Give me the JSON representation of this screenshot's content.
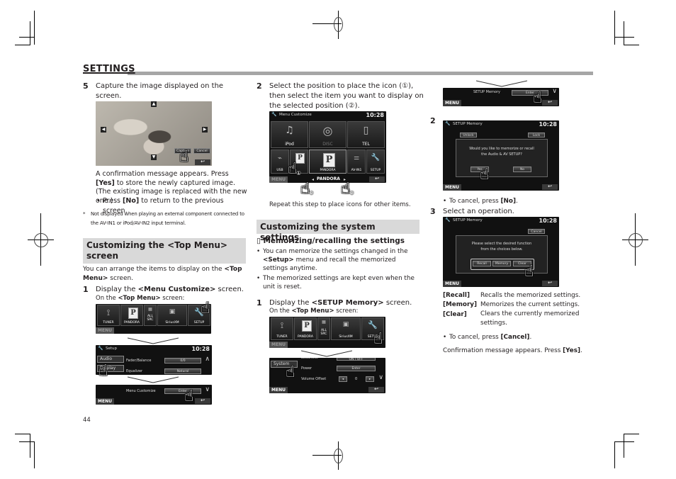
{
  "page": {
    "section_title": "SETTINGS",
    "page_number": "44"
  },
  "col1": {
    "step5": {
      "num": "5",
      "text": "Capture the image displayed on the screen.",
      "screen": {
        "capture_button": "Capture",
        "cancel_button": "Cancel",
        "back_button": "↩"
      },
      "confirm_text_1": "A confirmation message appears. Press ",
      "confirm_yes": "[Yes]",
      "confirm_text_2": " to store the newly captured image. (The existing image is replaced with the new one.)",
      "bullet_pre": "Press ",
      "bullet_no": "[No]",
      "bullet_post": " to return to the previous screen.",
      "footnote_mark": "*",
      "footnote_line1": "Not displayed when playing an external component connected to",
      "footnote_line2": "the AV-IN1 or iPod/AV-IN2 input terminal."
    },
    "topmenu_section": {
      "heading_line1": "Customizing the <Top Menu>",
      "heading_line2": "screen",
      "intro_pre": "You can arrange the items to display on the ",
      "intro_bold1": "<Top",
      "intro_bold2": "Menu>",
      "intro_post": " screen.",
      "step1_num": "1",
      "step1_pre": "Display the ",
      "step1_bold": "<Menu Customize>",
      "step1_post": " screen.",
      "step1_sub_pre": "On the ",
      "step1_sub_bold": "<Top Menu>",
      "step1_sub_post": " screen:"
    },
    "topmenu_screen": {
      "items": [
        "TUNER",
        "PANDORA",
        "ALL SRC",
        "SiriusXM",
        "SETUP"
      ],
      "menu": "MENU"
    },
    "setup_screen": {
      "title": "Setup",
      "clock": "10:28",
      "tabs": [
        "Audio",
        "Display"
      ],
      "rows": [
        {
          "label": "Fader/Balance",
          "value": "0/0"
        },
        {
          "label": "Equalizer",
          "value": "Natural"
        }
      ],
      "menu_customize_label": "Menu Customize",
      "enter": "Enter",
      "menu": "MENU"
    }
  },
  "col2": {
    "step2": {
      "num": "2",
      "text_1": "Select the position to place the icon (",
      "mark1": "①",
      "text_2": "), then select the item you want to display on the selected position (",
      "mark2": "②",
      "text_3": ").",
      "screen": {
        "title": "Menu Customize",
        "clock": "10:28",
        "top_items": [
          "iPod",
          "DISC",
          "TEL"
        ],
        "bottom_items": [
          "USB",
          "PANDORA",
          "AV-IN1",
          "SETUP"
        ],
        "selected_label": "PANDORA",
        "menu": "MENU"
      },
      "callout_1": "①",
      "callout_2": "②",
      "repeat_text": "Repeat this step to place icons for other items."
    },
    "system_section": {
      "heading": "Customizing the system settings",
      "sub_icon": "▯",
      "sub_heading": "Memorizing/recalling the settings",
      "bullet1_pre": "You can memorize the settings changed in the ",
      "bullet1_bold": "<Setup>",
      "bullet1_post": " menu and recall the memorized settings anytime.",
      "bullet2": "The memorized settings are kept even when the unit is reset.",
      "step1_num": "1",
      "step1_pre": "Display the ",
      "step1_bold": "<SETUP Memory>",
      "step1_post": " screen.",
      "step1_sub_pre": "On the ",
      "step1_sub_bold": "<Top Menu>",
      "step1_sub_post": " screen:"
    },
    "topmenu_screen": {
      "items": [
        "TUNER",
        "PANDORA",
        "ALL SRC",
        "SiriusXM",
        "SETUP"
      ],
      "menu": "MENU"
    },
    "system_screen": {
      "tab": "System",
      "rows": [
        {
          "label": "Loudness",
          "value": "ON / OFF"
        },
        {
          "label": "Power",
          "value": "Enter"
        },
        {
          "label": "Volume Offset",
          "value": "0"
        }
      ],
      "menu": "MENU"
    }
  },
  "col3": {
    "memory_row_screen": {
      "label": "SETUP Memory",
      "enter": "Enter",
      "menu": "MENU"
    },
    "step2": {
      "num": "2",
      "screen": {
        "title": "SETUP Memory",
        "clock": "10:28",
        "unlock": "Unlock",
        "lock": "Lock",
        "question_line1": "Would you like to memorize or recall",
        "question_line2": "the Audio & AV SETUP?",
        "yes": "Yes",
        "no": "No",
        "menu": "MENU"
      },
      "cancel_pre": "To cancel, press ",
      "cancel_bold": "[No]",
      "cancel_post": "."
    },
    "step3": {
      "num": "3",
      "text": "Select an operation.",
      "screen": {
        "title": "SETUP Memory",
        "clock": "10:28",
        "cancel": "Cancel",
        "prompt_line1": "Please select the desired function",
        "prompt_line2": "from the choices below.",
        "options": [
          "Recall",
          "Memory",
          "Clear"
        ],
        "menu": "MENU"
      },
      "definitions": [
        {
          "term": "[Recall]",
          "desc": "Recalls the memorized settings."
        },
        {
          "term": "[Memory]",
          "desc": "Memorizes the current settings."
        },
        {
          "term": "[Clear]",
          "desc": "Clears the currently memorized settings."
        }
      ],
      "cancel_pre": "To cancel, press ",
      "cancel_bold": "[Cancel]",
      "cancel_post": ".",
      "confirm_pre": "Confirmation message appears. Press ",
      "confirm_bold": "[Yes]",
      "confirm_post": "."
    }
  },
  "colors": {
    "heading_bar": "#a6a6a6",
    "heading_box": "#d9d9d9",
    "screen_bg": "#111111"
  }
}
